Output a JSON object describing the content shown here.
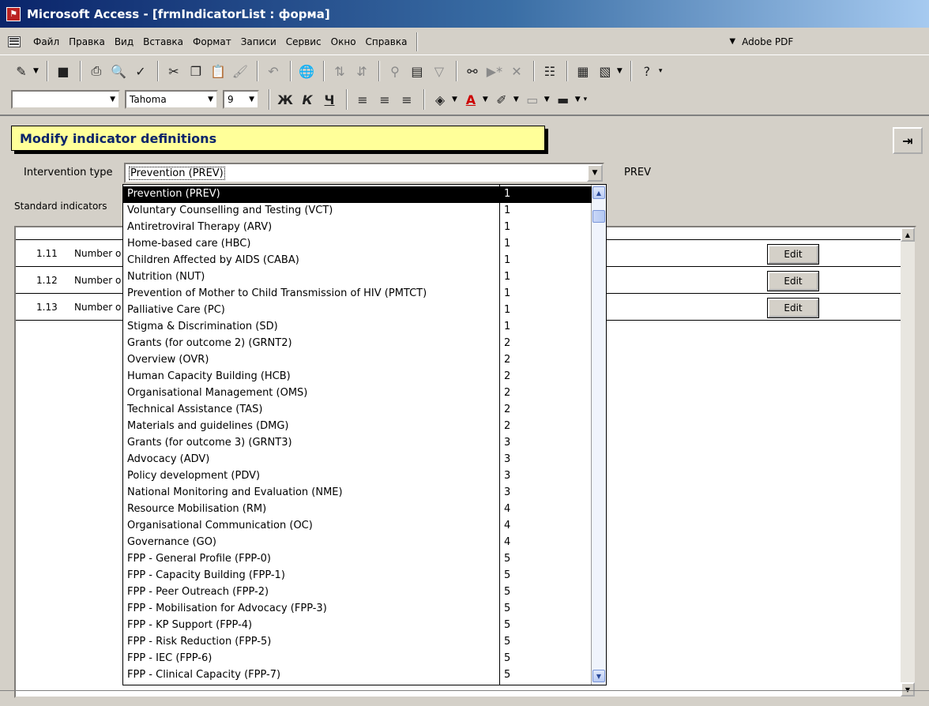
{
  "window": {
    "title": "Microsoft Access - [frmIndicatorList : форма]"
  },
  "menu": {
    "items": [
      "Файл",
      "Правка",
      "Вид",
      "Вставка",
      "Формат",
      "Записи",
      "Сервис",
      "Окно",
      "Справка"
    ],
    "pdf": "Adobe PDF"
  },
  "format_toolbar": {
    "font": "Tahoma",
    "size": "9",
    "bold": "Ж",
    "italic": "К",
    "underline": "Ч"
  },
  "form": {
    "heading": "Modify indicator definitions",
    "intervention_label": "Intervention type",
    "intervention_value": "Prevention (PREV)",
    "intervention_code": "PREV",
    "standard_label": "Standard indicators",
    "edit_label": "Edit",
    "rows": [
      {
        "num": "1.11",
        "desc": "Number o"
      },
      {
        "num": "1.12",
        "desc": "Number o"
      },
      {
        "num": "1.13",
        "desc": "Number o"
      }
    ]
  },
  "dropdown": {
    "options": [
      {
        "name": "Prevention (PREV)",
        "group": "1"
      },
      {
        "name": "Voluntary Counselling and Testing (VCT)",
        "group": "1"
      },
      {
        "name": "Antiretroviral Therapy (ARV)",
        "group": "1"
      },
      {
        "name": "Home-based care (HBC)",
        "group": "1"
      },
      {
        "name": "Children Affected by AIDS (CABA)",
        "group": "1"
      },
      {
        "name": "Nutrition (NUT)",
        "group": "1"
      },
      {
        "name": "Prevention of Mother to Child Transmission of HIV (PMTCT)",
        "group": "1"
      },
      {
        "name": "Palliative Care (PC)",
        "group": "1"
      },
      {
        "name": "Stigma & Discrimination (SD)",
        "group": "1"
      },
      {
        "name": "Grants (for outcome 2) (GRNT2)",
        "group": "2"
      },
      {
        "name": "Overview (OVR)",
        "group": "2"
      },
      {
        "name": "Human Capacity Building (HCB)",
        "group": "2"
      },
      {
        "name": "Organisational Management (OMS)",
        "group": "2"
      },
      {
        "name": "Technical Assistance (TAS)",
        "group": "2"
      },
      {
        "name": "Materials and guidelines (DMG)",
        "group": "2"
      },
      {
        "name": "Grants (for outcome 3) (GRNT3)",
        "group": "3"
      },
      {
        "name": "Advocacy (ADV)",
        "group": "3"
      },
      {
        "name": "Policy development (PDV)",
        "group": "3"
      },
      {
        "name": "National Monitoring and Evaluation (NME)",
        "group": "3"
      },
      {
        "name": "Resource Mobilisation (RM)",
        "group": "4"
      },
      {
        "name": "Organisational Communication (OC)",
        "group": "4"
      },
      {
        "name": "Governance (GO)",
        "group": "4"
      },
      {
        "name": "FPP - General Profile (FPP-0)",
        "group": "5"
      },
      {
        "name": "FPP - Capacity Building (FPP-1)",
        "group": "5"
      },
      {
        "name": "FPP - Peer Outreach (FPP-2)",
        "group": "5"
      },
      {
        "name": "FPP - Mobilisation for Advocacy (FPP-3)",
        "group": "5"
      },
      {
        "name": "FPP - KP Support (FPP-4)",
        "group": "5"
      },
      {
        "name": "FPP - Risk Reduction (FPP-5)",
        "group": "5"
      },
      {
        "name": "FPP - IEC (FPP-6)",
        "group": "5"
      },
      {
        "name": "FPP - Clinical Capacity (FPP-7)",
        "group": "5"
      }
    ]
  }
}
